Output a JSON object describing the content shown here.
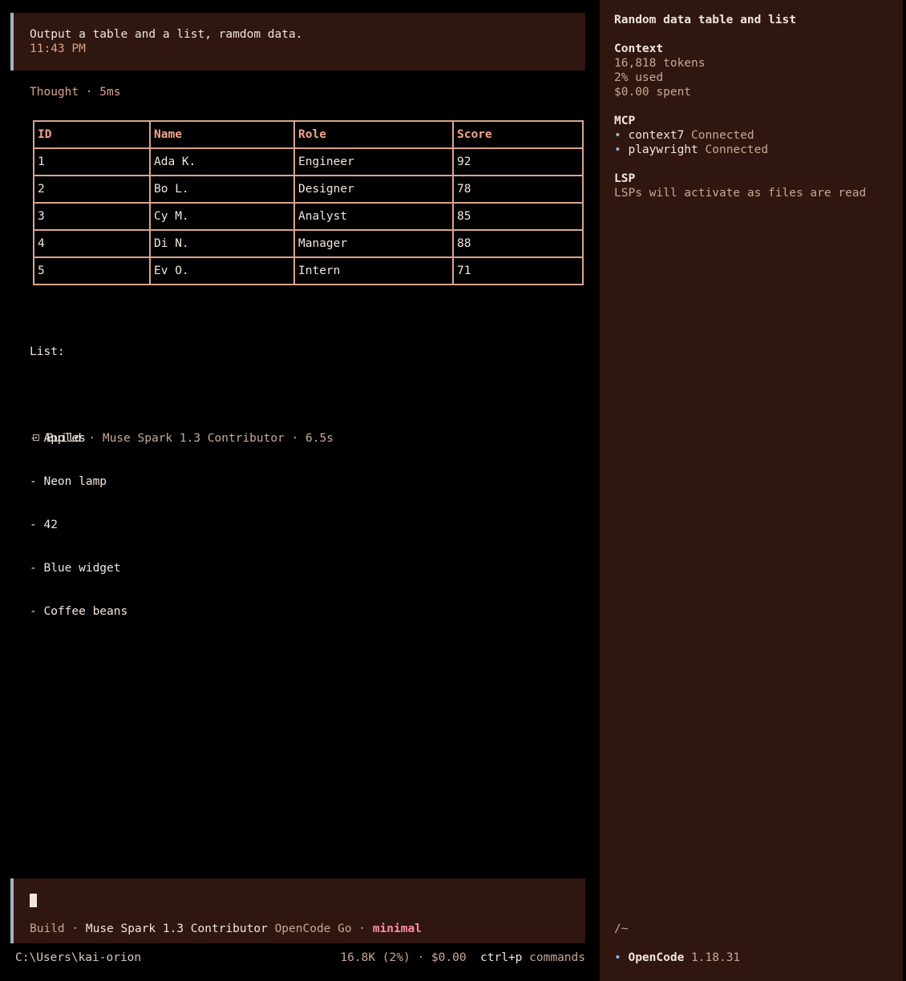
{
  "user_message": {
    "text": "Output a table and a list, ramdom data.",
    "time": "11:43 PM"
  },
  "thought": "Thought · 5ms",
  "table": {
    "headers": [
      "ID",
      "Name",
      "Role",
      "Score"
    ],
    "rows": [
      [
        "1",
        "Ada K.",
        "Engineer",
        "92"
      ],
      [
        "2",
        "Bo L.",
        "Designer",
        "78"
      ],
      [
        "3",
        "Cy M.",
        "Analyst",
        "85"
      ],
      [
        "4",
        "Di N.",
        "Manager",
        "88"
      ],
      [
        "5",
        "Ev O.",
        "Intern",
        "71"
      ]
    ]
  },
  "list": {
    "title": "List:",
    "items": [
      "- Apples",
      "- Neon lamp",
      "- 42",
      "- Blue widget",
      "- Coffee beans"
    ]
  },
  "build_status": {
    "icon": "square-dot-icon",
    "mode": "Build",
    "detail": "· Muse Spark 1.3 Contributor · 6.5s"
  },
  "input": {
    "mode": "Build",
    "sep": "·",
    "model": "Muse Spark 1.3 Contributor",
    "provider": "OpenCode Go",
    "sep2": "·",
    "variant": "minimal"
  },
  "status_bar": {
    "path": "C:\\Users\\kai-orion",
    "usage": "16.8K (2%) · $0.00",
    "shortcut_key": "ctrl+p",
    "shortcut_label": "commands"
  },
  "sidebar": {
    "title": "Random data table and list",
    "context": {
      "heading": "Context",
      "tokens": "16,818 tokens",
      "used": "2% used",
      "spent": "$0.00 spent"
    },
    "mcp": {
      "heading": "MCP",
      "servers": [
        {
          "name": "context7",
          "status": "Connected"
        },
        {
          "name": "playwright",
          "status": "Connected"
        }
      ]
    },
    "lsp": {
      "heading": "LSP",
      "note": "LSPs will activate as files are read"
    },
    "cwd": "/~",
    "app_name": "OpenCode",
    "version": "1.18.31"
  },
  "colors": {
    "background": "#000000",
    "panel": "#2f160e",
    "accent_border": "#9fb3c4",
    "muted": "#d9a48f",
    "header": "#f4a58a",
    "variant": "#ff8fa0",
    "bullet": "#8fb8d6"
  }
}
